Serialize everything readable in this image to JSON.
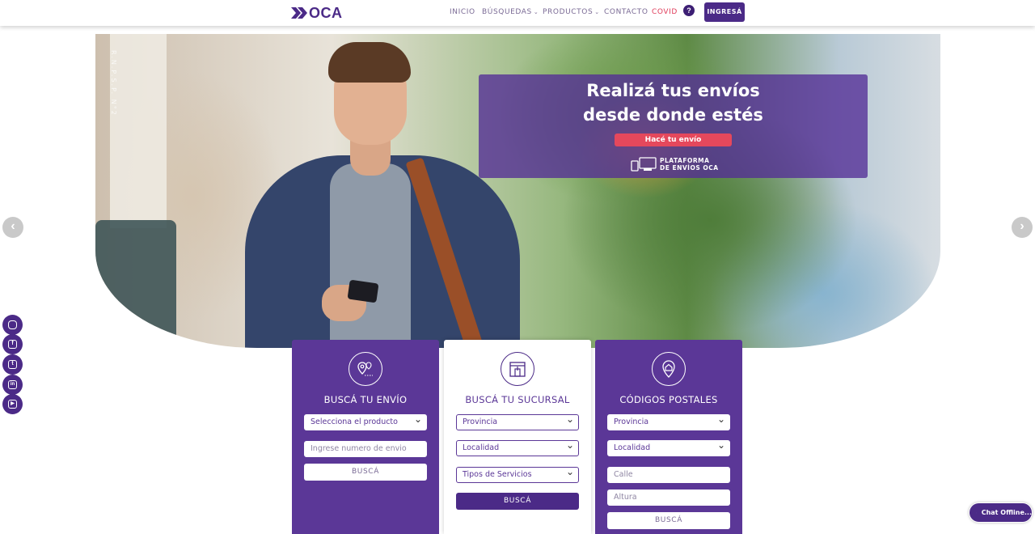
{
  "brand": {
    "logo_text": "OCA",
    "primary_color": "#4b2a87",
    "accent_color": "#e5485c"
  },
  "nav": {
    "items": [
      {
        "label": "INICIO",
        "has_caret": false
      },
      {
        "label": "BÚSQUEDAS",
        "has_caret": true
      },
      {
        "label": "PRODUCTOS",
        "has_caret": true
      },
      {
        "label": "CONTACTO",
        "has_caret": false
      },
      {
        "label": "COVID",
        "has_caret": false
      }
    ],
    "help_icon": "?",
    "login_label": "INGRESÁ"
  },
  "hero": {
    "vertical_text": "R.N.P.S.P. N°2",
    "title_line1": "Realizá tus envíos",
    "title_line2": "desde donde estés",
    "cta_label": "Hacé tu envío",
    "platform_line1": "PLATAFORMA",
    "platform_line2": "DE ENVÍOS OCA",
    "prev_arrow": "‹",
    "next_arrow": "›"
  },
  "social": [
    {
      "name": "instagram-icon",
      "glyph": ""
    },
    {
      "name": "facebook-icon",
      "glyph": "f"
    },
    {
      "name": "twitter-icon",
      "glyph": "t"
    },
    {
      "name": "linkedin-icon",
      "glyph": "in"
    },
    {
      "name": "youtube-icon",
      "glyph": "▶"
    }
  ],
  "cards": {
    "envio": {
      "title": "BUSCÁ TU ENVÍO",
      "product_select": "Selecciona el producto",
      "tracking_placeholder": "Ingrese numero de envio",
      "button": "BUSCÁ"
    },
    "sucursal": {
      "title": "BUSCÁ TU SUCURSAL",
      "province_select": "Provincia",
      "locality_select": "Localidad",
      "services_select": "Tipos de Servicios",
      "button": "BUSCÁ"
    },
    "postal": {
      "title": "CÓDIGOS POSTALES",
      "province_select": "Provincia",
      "locality_select": "Localidad",
      "street_placeholder": "Calle",
      "height_placeholder": "Altura",
      "button": "BUSCÁ"
    }
  },
  "chat": {
    "label": "Chat Offline..."
  }
}
